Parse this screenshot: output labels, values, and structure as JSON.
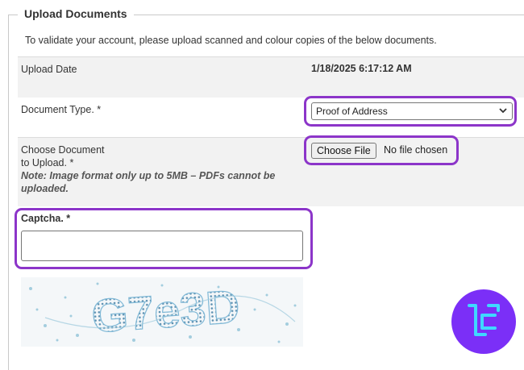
{
  "section": {
    "legend": "Upload Documents",
    "intro": "To validate your account, please upload scanned and colour copies of the below documents."
  },
  "upload_date": {
    "label": "Upload Date",
    "value": "1/18/2025 6:17:12 AM"
  },
  "document_type": {
    "label": "Document Type. *",
    "selected": "Proof of Address"
  },
  "choose_document": {
    "label_line1": "Choose Document",
    "label_line2": "to Upload. *",
    "note_line1": "Note: Image format only up to 5MB – PDFs cannot be",
    "note_line2": "uploaded.",
    "button_label": "Choose File",
    "status": "No file chosen"
  },
  "captcha": {
    "label": "Captcha. *",
    "value": "",
    "image_text": "G7e3D"
  },
  "colors": {
    "highlight": "#8c35c9",
    "logo_bg": "#7b2ff7",
    "logo_fg": "#3fd8ff"
  },
  "icons": {
    "select_arrow": "chevron-down-icon",
    "logo": "brand-logo-icon"
  }
}
